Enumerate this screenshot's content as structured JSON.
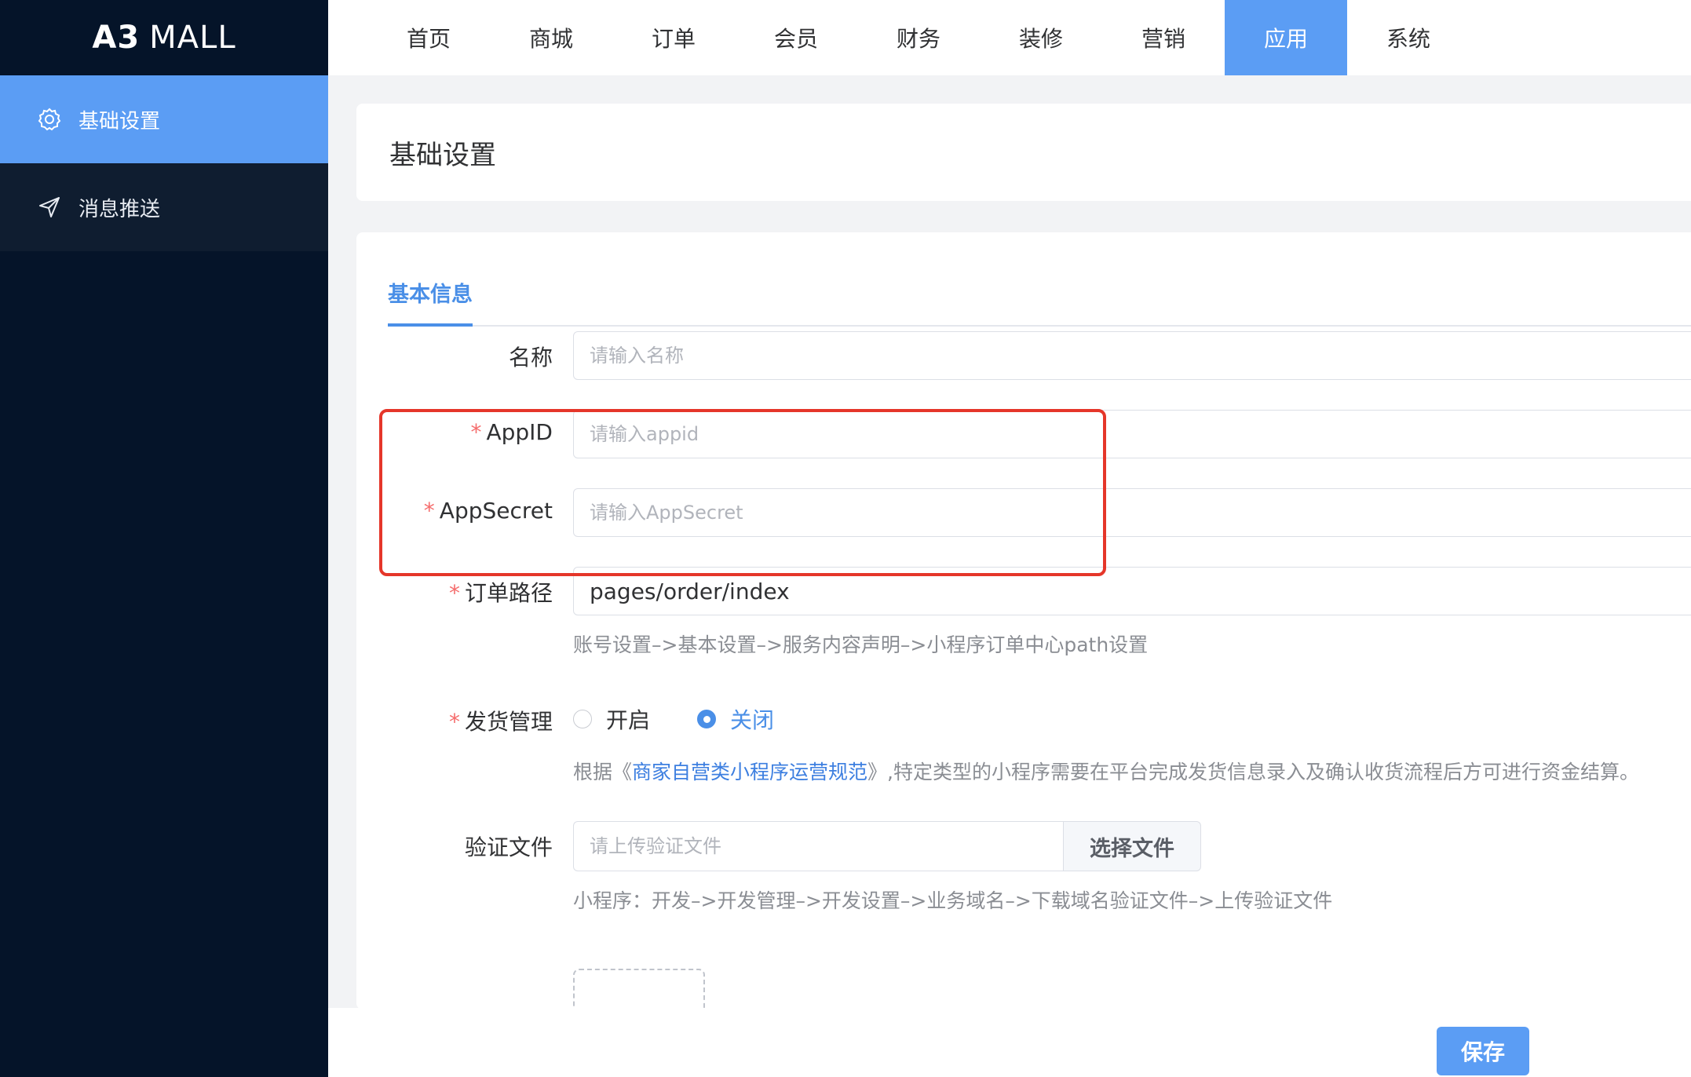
{
  "logo": {
    "brand": "A3",
    "name": "MALL"
  },
  "sidebar": {
    "items": [
      {
        "label": "基础设置",
        "icon": "gear-icon",
        "active": true
      },
      {
        "label": "消息推送",
        "icon": "send-icon",
        "active": false
      }
    ]
  },
  "topnav": {
    "items": [
      "首页",
      "商城",
      "订单",
      "会员",
      "财务",
      "装修",
      "营销",
      "应用",
      "系统"
    ],
    "active": "应用"
  },
  "page": {
    "title": "基础设置"
  },
  "tabs": {
    "active": "基本信息"
  },
  "form": {
    "name": {
      "label": "名称",
      "placeholder": "请输入名称",
      "value": ""
    },
    "appid": {
      "label": "AppID",
      "placeholder": "请输入appid",
      "value": "",
      "required": true
    },
    "appsecret": {
      "label": "AppSecret",
      "placeholder": "请输入AppSecret",
      "value": "",
      "required": true
    },
    "order_path": {
      "label": "订单路径",
      "value": "pages/order/index",
      "required": true,
      "help": "账号设置–>基本设置–>服务内容声明–>小程序订单中心path设置"
    },
    "shipping": {
      "label": "发货管理",
      "required": true,
      "options": [
        "开启",
        "关闭"
      ],
      "selected": "关闭",
      "help_prefix": "根据《",
      "help_link": "商家自营类小程序运营规范",
      "help_suffix": "》,特定类型的小程序需要在平台完成发货信息录入及确认收货流程后方可进行资金结算。"
    },
    "verify_file": {
      "label": "验证文件",
      "placeholder": "请上传验证文件",
      "button": "选择文件",
      "help": "小程序：开发–>开发管理–>开发设置–>业务域名–>下载域名验证文件–>上传验证文件"
    },
    "required_mark": "*"
  },
  "actions": {
    "save": "保存"
  },
  "colors": {
    "accent": "#5b9df4",
    "sidebar_bg": "#051429",
    "required": "#f56c6c",
    "highlight": "#e5362a"
  }
}
